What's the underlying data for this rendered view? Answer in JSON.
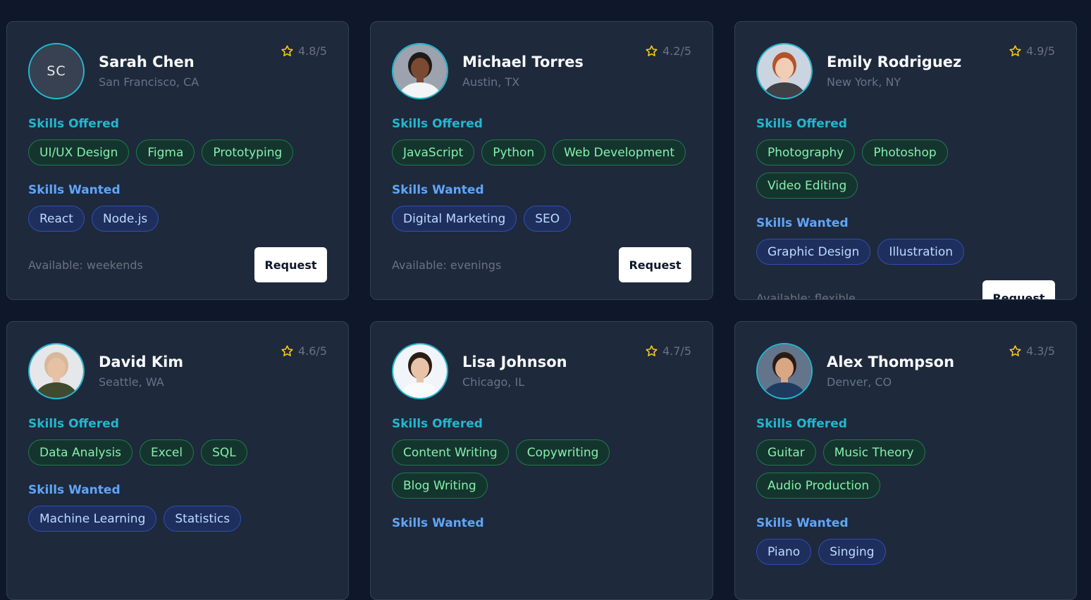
{
  "labels": {
    "skills_offered": "Skills Offered",
    "skills_wanted": "Skills Wanted",
    "request": "Request"
  },
  "colors": {
    "background": "#0f172a",
    "card": "#1e293b",
    "accent_offered": "#22b8cf",
    "accent_wanted": "#60a5fa",
    "star": "#facc15"
  },
  "profiles": [
    {
      "name": "Sarah Chen",
      "location": "San Francisco, CA",
      "rating": "4.8/5",
      "initials": "SC",
      "avatar": "initials",
      "skills_offered": [
        "UI/UX Design",
        "Figma",
        "Prototyping"
      ],
      "skills_wanted": [
        "React",
        "Node.js"
      ],
      "availability": "Available: weekends"
    },
    {
      "name": "Michael Torres",
      "location": "Austin, TX",
      "rating": "4.2/5",
      "initials": "",
      "avatar": "photo",
      "skills_offered": [
        "JavaScript",
        "Python",
        "Web Development"
      ],
      "skills_wanted": [
        "Digital Marketing",
        "SEO"
      ],
      "availability": "Available: evenings"
    },
    {
      "name": "Emily Rodriguez",
      "location": "New York, NY",
      "rating": "4.9/5",
      "initials": "",
      "avatar": "photo",
      "skills_offered": [
        "Photography",
        "Photoshop",
        "Video Editing"
      ],
      "skills_wanted": [
        "Graphic Design",
        "Illustration"
      ],
      "availability": "Available: flexible"
    },
    {
      "name": "David Kim",
      "location": "Seattle, WA",
      "rating": "4.6/5",
      "initials": "",
      "avatar": "photo",
      "skills_offered": [
        "Data Analysis",
        "Excel",
        "SQL"
      ],
      "skills_wanted": [
        "Machine Learning",
        "Statistics"
      ],
      "availability": ""
    },
    {
      "name": "Lisa Johnson",
      "location": "Chicago, IL",
      "rating": "4.7/5",
      "initials": "",
      "avatar": "photo",
      "skills_offered": [
        "Content Writing",
        "Copywriting",
        "Blog Writing"
      ],
      "skills_wanted": [],
      "availability": ""
    },
    {
      "name": "Alex Thompson",
      "location": "Denver, CO",
      "rating": "4.3/5",
      "initials": "",
      "avatar": "photo",
      "skills_offered": [
        "Guitar",
        "Music Theory",
        "Audio Production"
      ],
      "skills_wanted": [
        "Piano",
        "Singing"
      ],
      "availability": ""
    }
  ]
}
